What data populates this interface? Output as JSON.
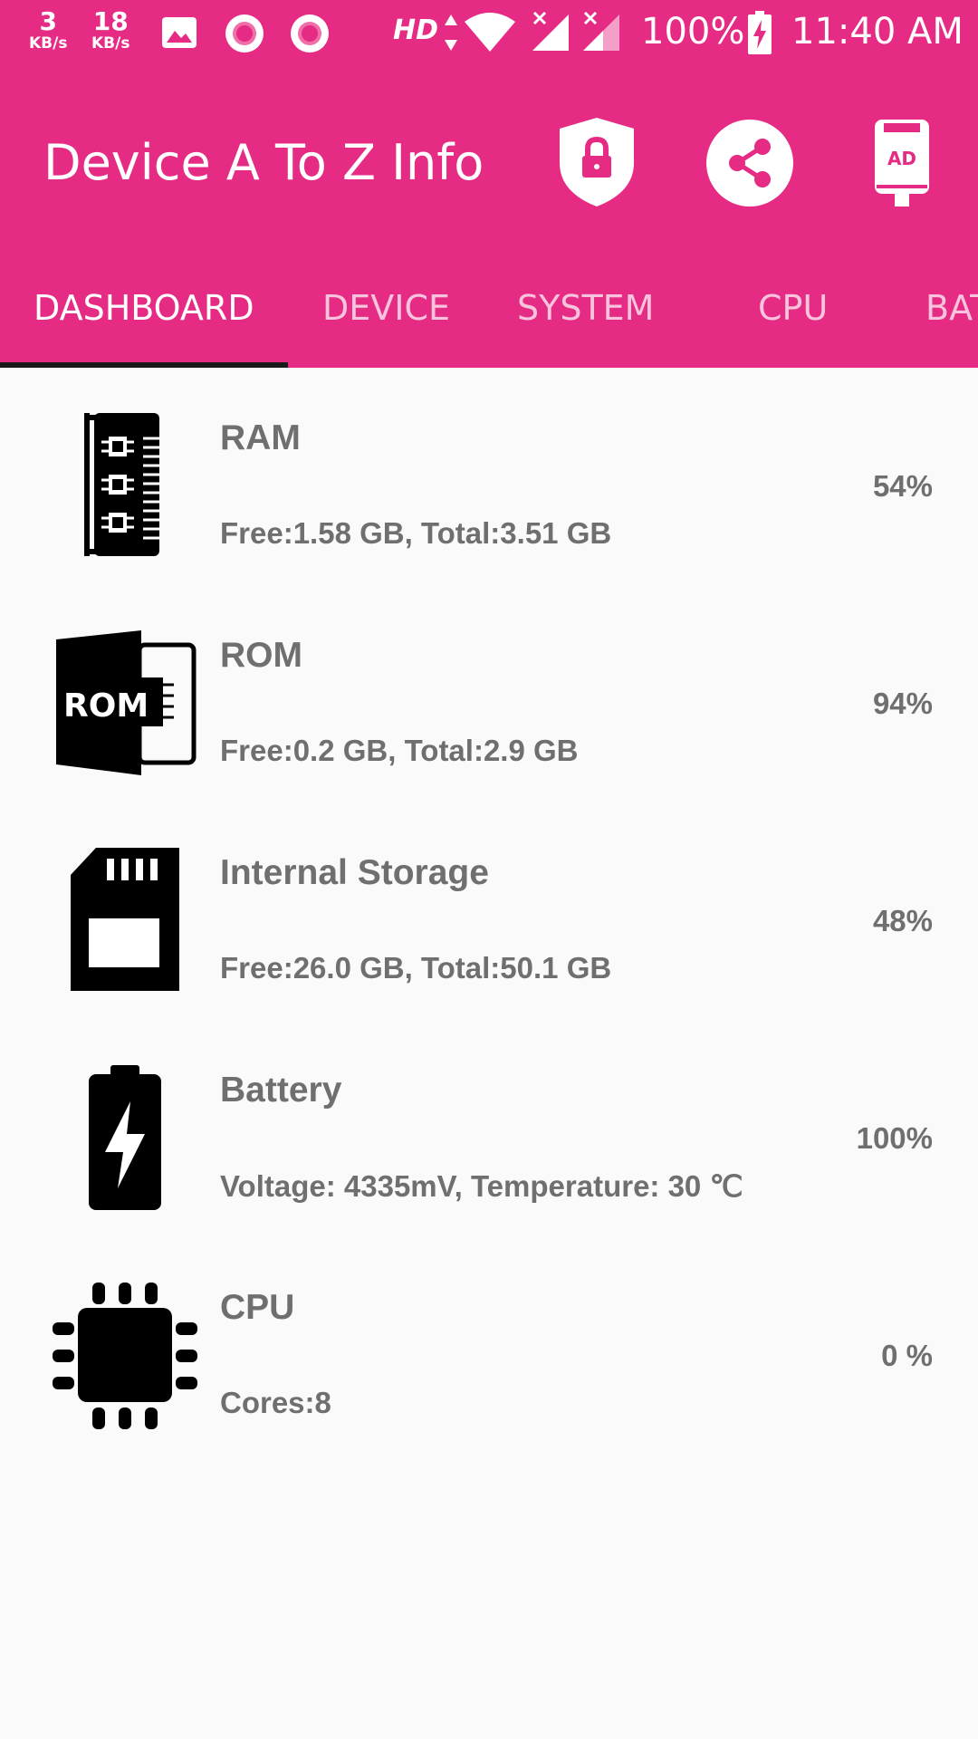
{
  "status_bar": {
    "speed_up": {
      "value": "3",
      "unit": "KB/s"
    },
    "speed_down": {
      "value": "18",
      "unit": "KB/s"
    },
    "hd": "HD",
    "battery": "100%",
    "time": "11:40 AM",
    "icons": [
      "image-icon",
      "record-icon",
      "record-icon",
      "data-arrows-icon",
      "wifi-icon",
      "signal-icon",
      "signal-icon",
      "battery-charging-icon"
    ]
  },
  "toolbar": {
    "title": "Device A To Z Info",
    "actions": [
      "shield-lock-icon",
      "share-icon",
      "remove-ads-icon"
    ]
  },
  "tabs": [
    "DASHBOARD",
    "DEVICE",
    "SYSTEM",
    "CPU",
    "BAT"
  ],
  "active_tab": "DASHBOARD",
  "items": [
    {
      "title": "RAM",
      "detail": "Free:1.58 GB, Total:3.51 GB",
      "percent": "54%",
      "icon": "ram-icon"
    },
    {
      "title": "ROM",
      "detail": "Free:0.2 GB, Total:2.9 GB",
      "percent": "94%",
      "icon": "rom-icon",
      "icon_text": "ROM"
    },
    {
      "title": "Internal Storage",
      "detail": "Free:26.0 GB, Total:50.1 GB",
      "percent": "48%",
      "icon": "sd-card-icon"
    },
    {
      "title": "Battery",
      "detail": "Voltage: 4335mV, Temperature: 30 ℃",
      "percent": "100%",
      "icon": "battery-icon"
    },
    {
      "title": "CPU",
      "detail": "Cores:8",
      "percent": "0 %",
      "icon": "cpu-chip-icon"
    }
  ],
  "colors": {
    "primary": "#e52b84",
    "indicator": "#1a1a1a",
    "text": "#6f6f6f",
    "background": "#fafafa"
  }
}
